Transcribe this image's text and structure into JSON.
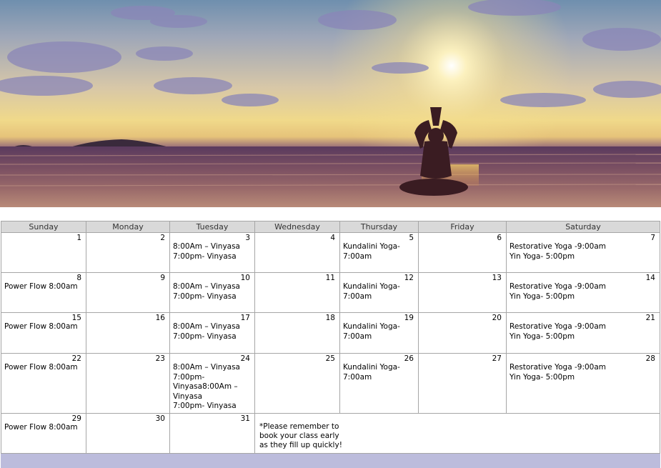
{
  "banner": {
    "scene": "yoga-silhouette-beach-sunset",
    "colors": {
      "sky_top": "#6f8fae",
      "sun": "#fff6d0",
      "sea": "#5b3c5a",
      "sand": "#b08676"
    }
  },
  "calendar": {
    "days": [
      "Sunday",
      "Monday",
      "Tuesday",
      "Wednesday",
      "Thursday",
      "Friday",
      "Saturday"
    ],
    "weeks": [
      [
        {
          "n": "1",
          "ev": []
        },
        {
          "n": "2",
          "ev": []
        },
        {
          "n": "3",
          "ev": [
            "8:00Am – Vinyasa",
            "7:00pm- Vinyasa"
          ]
        },
        {
          "n": "4",
          "ev": []
        },
        {
          "n": "5",
          "ev": [
            "Kundalini Yoga-",
            "7:00am"
          ]
        },
        {
          "n": "6",
          "ev": []
        },
        {
          "n": "7",
          "ev": [
            "Restorative Yoga -9:00am",
            "Yin Yoga- 5:00pm"
          ]
        }
      ],
      [
        {
          "n": "8",
          "ev": [
            "Power Flow 8:00am"
          ]
        },
        {
          "n": "9",
          "ev": []
        },
        {
          "n": "10",
          "ev": [
            "8:00Am – Vinyasa",
            "7:00pm- Vinyasa"
          ]
        },
        {
          "n": "11",
          "ev": []
        },
        {
          "n": "12",
          "ev": [
            "Kundalini Yoga-",
            "7:00am"
          ]
        },
        {
          "n": "13",
          "ev": []
        },
        {
          "n": "14",
          "ev": [
            "Restorative Yoga -9:00am",
            "Yin Yoga- 5:00pm"
          ]
        }
      ],
      [
        {
          "n": "15",
          "ev": [
            "Power Flow 8:00am"
          ]
        },
        {
          "n": "16",
          "ev": []
        },
        {
          "n": "17",
          "ev": [
            "8:00Am – Vinyasa",
            "7:00pm- Vinyasa"
          ]
        },
        {
          "n": "18",
          "ev": []
        },
        {
          "n": "19",
          "ev": [
            "Kundalini Yoga-",
            "7:00am"
          ]
        },
        {
          "n": "20",
          "ev": []
        },
        {
          "n": "21",
          "ev": [
            "Restorative Yoga -9:00am",
            "Yin Yoga- 5:00pm"
          ]
        }
      ],
      [
        {
          "n": "22",
          "ev": [
            "Power Flow 8:00am"
          ]
        },
        {
          "n": "23",
          "ev": []
        },
        {
          "n": "24",
          "ev": [
            "8:00Am – Vinyasa",
            "7:00pm-",
            "Vinyasa8:00Am –",
            "Vinyasa",
            "7:00pm- Vinyasa"
          ]
        },
        {
          "n": "25",
          "ev": []
        },
        {
          "n": "26",
          "ev": [
            "Kundalini Yoga-",
            "7:00am"
          ]
        },
        {
          "n": "27",
          "ev": []
        },
        {
          "n": "28",
          "ev": [
            "Restorative Yoga -9:00am",
            "Yin Yoga- 5:00pm"
          ]
        }
      ],
      [
        {
          "n": "29",
          "ev": [
            "Power Flow 8:00am"
          ]
        },
        {
          "n": "30",
          "ev": []
        },
        {
          "n": "31",
          "ev": []
        }
      ]
    ],
    "note": [
      "*Please remember to",
      "book your class early",
      "as they fill up quickly!"
    ],
    "colors": {
      "header": "#d9d9d9",
      "weekend": "#f8f8c8",
      "note": "#bcbcdc",
      "border": "#a6a6a6"
    }
  }
}
